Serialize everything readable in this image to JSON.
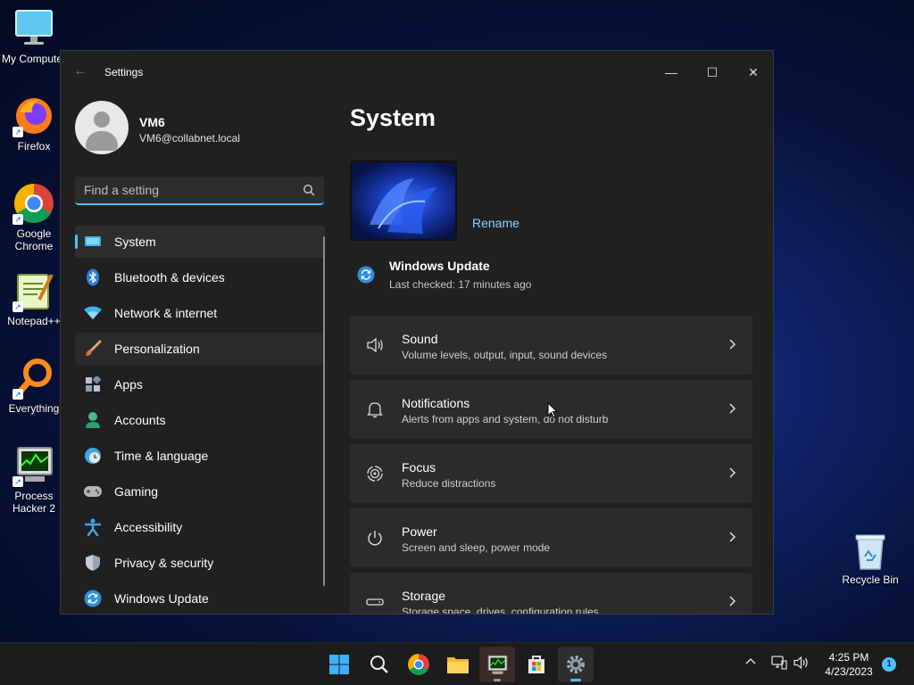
{
  "desktop": {
    "icons": [
      {
        "label": "My Computer"
      },
      {
        "label": "Firefox"
      },
      {
        "label": "Google Chrome"
      },
      {
        "label": "Notepad++"
      },
      {
        "label": "Everything"
      },
      {
        "label": "Process Hacker 2"
      }
    ],
    "recycle_bin": "Recycle Bin"
  },
  "window": {
    "title": "Settings",
    "controls": {
      "minimize": "—",
      "maximize": "☐",
      "close": "✕"
    }
  },
  "profile": {
    "name": "VM6",
    "email": "VM6@collabnet.local"
  },
  "search": {
    "placeholder": "Find a setting"
  },
  "nav": {
    "items": [
      {
        "label": "System",
        "icon": "system-icon",
        "state": "active"
      },
      {
        "label": "Bluetooth & devices",
        "icon": "bluetooth-icon"
      },
      {
        "label": "Network & internet",
        "icon": "wifi-icon"
      },
      {
        "label": "Personalization",
        "icon": "brush-icon",
        "state": "hover"
      },
      {
        "label": "Apps",
        "icon": "apps-icon"
      },
      {
        "label": "Accounts",
        "icon": "accounts-icon"
      },
      {
        "label": "Time & language",
        "icon": "globe-clock-icon"
      },
      {
        "label": "Gaming",
        "icon": "gamepad-icon"
      },
      {
        "label": "Accessibility",
        "icon": "accessibility-icon"
      },
      {
        "label": "Privacy & security",
        "icon": "shield-icon"
      },
      {
        "label": "Windows Update",
        "icon": "update-icon"
      }
    ]
  },
  "main": {
    "title": "System",
    "rename": "Rename",
    "update": {
      "title": "Windows Update",
      "subtitle": "Last checked: 17 minutes ago"
    },
    "cards": [
      {
        "title": "Sound",
        "subtitle": "Volume levels, output, input, sound devices",
        "icon": "speaker-icon"
      },
      {
        "title": "Notifications",
        "subtitle": "Alerts from apps and system, do not disturb",
        "icon": "bell-icon"
      },
      {
        "title": "Focus",
        "subtitle": "Reduce distractions",
        "icon": "focus-icon"
      },
      {
        "title": "Power",
        "subtitle": "Screen and sleep, power mode",
        "icon": "power-icon"
      },
      {
        "title": "Storage",
        "subtitle": "Storage space, drives, configuration rules",
        "icon": "storage-icon"
      }
    ]
  },
  "taskbar": {
    "clock": {
      "time": "4:25 PM",
      "date": "4/23/2023"
    },
    "notification_count": "1"
  },
  "colors": {
    "accent": "#4cc2ff",
    "window_bg": "#202020",
    "card_bg": "#2b2b2b"
  }
}
